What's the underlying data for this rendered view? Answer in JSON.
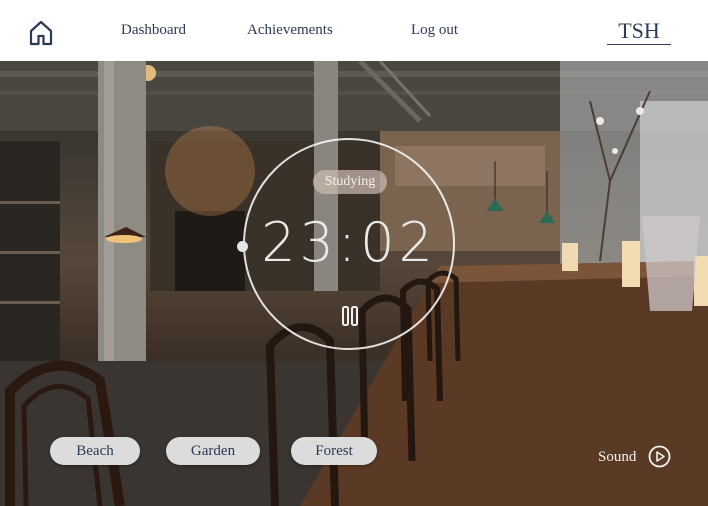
{
  "nav": {
    "home_icon": "home-icon",
    "links": [
      "Dashboard",
      "Achievements",
      "Log out"
    ],
    "brand": "TSH"
  },
  "timer": {
    "status": "Studying",
    "time": "23:02",
    "pause_icon": "pause-icon"
  },
  "scenes": [
    "Beach",
    "Garden",
    "Forest"
  ],
  "sound": {
    "label": "Sound",
    "icon": "play-icon"
  },
  "colors": {
    "nav_text": "#2b3a55",
    "navbar_bg": "#ffffff",
    "chip_bg": "#dcdcdc",
    "ring": "#ffffff"
  }
}
